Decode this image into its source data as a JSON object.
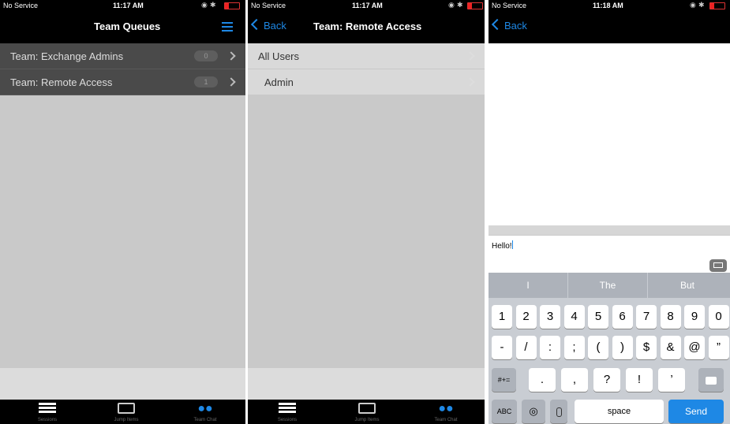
{
  "status": {
    "service": "No Service",
    "time_1": "11:17 AM",
    "time_2": "11:17 AM",
    "time_3": "11:18 AM"
  },
  "panel1": {
    "title": "Team Queues",
    "rows": [
      {
        "label": "Team: Exchange Admins",
        "badge": "0"
      },
      {
        "label": "Team: Remote Access",
        "badge": "1"
      }
    ]
  },
  "panel2": {
    "back": "Back",
    "title": "Team: Remote Access",
    "rows": [
      {
        "label": "All Users"
      },
      {
        "label": "Admin"
      }
    ]
  },
  "panel3": {
    "back": "Back",
    "message": "Hello!",
    "predictions": [
      "I",
      "The",
      "But"
    ],
    "row1": [
      "1",
      "2",
      "3",
      "4",
      "5",
      "6",
      "7",
      "8",
      "9",
      "0"
    ],
    "row2": [
      "-",
      "/",
      ":",
      ";",
      "(",
      ")",
      "$",
      "&",
      "@",
      "”"
    ],
    "row3": [
      ".",
      ",",
      "?",
      "!",
      "’"
    ],
    "symbols_key": "#+=",
    "abc_key": "ABC",
    "space_key": "space",
    "send_key": "Send"
  },
  "tabs": [
    "Sessions",
    "Jump Items",
    "Team Chat"
  ],
  "colors": {
    "accent": "#1e88e5"
  }
}
